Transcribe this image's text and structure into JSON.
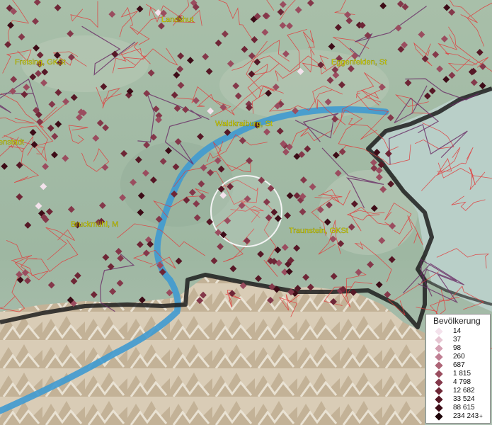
{
  "map": {
    "places": [
      {
        "name": "Landshut"
      },
      {
        "name": "Freising, GKSt"
      },
      {
        "name": "Eggenfelden, St"
      },
      {
        "name": "Waldkraiburg, St"
      },
      {
        "name": "Bruckmühl, M"
      },
      {
        "name": "Traunstein, GKSt"
      },
      {
        "name": "enstadt"
      }
    ]
  },
  "legend": {
    "title": "Bevölkerung",
    "classes": [
      {
        "label": "14",
        "color": "#f4e2ec"
      },
      {
        "label": "37",
        "color": "#e6c5d2"
      },
      {
        "label": "98",
        "color": "#d4a0b2"
      },
      {
        "label": "260",
        "color": "#c07f93"
      },
      {
        "label": "687",
        "color": "#ad6476"
      },
      {
        "label": "1 815",
        "color": "#9a4d5f"
      },
      {
        "label": "4 798",
        "color": "#84384a"
      },
      {
        "label": "12 682",
        "color": "#6e2636"
      },
      {
        "label": "33 524",
        "color": "#561826"
      },
      {
        "label": "88 615",
        "color": "#3d0c17"
      },
      {
        "label": "234 243",
        "color": "#1c0308",
        "plus": "+"
      }
    ]
  },
  "colors": {
    "border_red": "#e23a3a",
    "river": "#3f9ad0",
    "mountain_light": "#e4d8c3",
    "lake_country": "#a9c8c3",
    "country_border": "#1d1d1d",
    "label_yellow": "#e8e800"
  }
}
